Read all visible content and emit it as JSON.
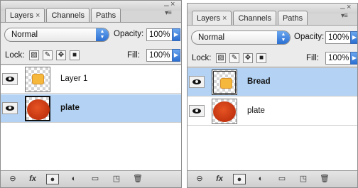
{
  "panels": [
    {
      "tabs": [
        "Layers",
        "Channels",
        "Paths"
      ],
      "blend_mode": "Normal",
      "opacity_label": "Opacity:",
      "opacity_value": "100%",
      "lock_label": "Lock:",
      "fill_label": "Fill:",
      "fill_value": "100%",
      "layers": [
        {
          "name": "Layer 1",
          "content": "bread",
          "selected": false,
          "visible": true
        },
        {
          "name": "plate",
          "content": "plate",
          "selected": true,
          "visible": true
        }
      ]
    },
    {
      "tabs": [
        "Layers",
        "Channels",
        "Paths"
      ],
      "blend_mode": "Normal",
      "opacity_label": "Opacity:",
      "opacity_value": "100%",
      "lock_label": "Lock:",
      "fill_label": "Fill:",
      "fill_value": "100%",
      "layers": [
        {
          "name": "Bread",
          "content": "bread",
          "selected": true,
          "visible": true
        },
        {
          "name": "plate",
          "content": "plate",
          "selected": false,
          "visible": true
        }
      ]
    }
  ],
  "glyphs": {
    "close": "×",
    "minimize": "–",
    "panel_menu": "▾≡",
    "fx": "fx"
  },
  "icons": {
    "bottom_bar": [
      "link-layers-icon",
      "fx-icon",
      "layer-mask-icon",
      "adjustment-layer-icon",
      "new-group-icon",
      "new-layer-icon",
      "trash-icon"
    ],
    "lock": [
      "lock-transparent-icon",
      "lock-paint-icon",
      "lock-move-icon",
      "lock-all-icon"
    ]
  },
  "colors": {
    "selection": "#b4d3f4",
    "accent_blue": "#2b6fd2",
    "bread": "#f6b83c",
    "plate": "#c2330f"
  }
}
